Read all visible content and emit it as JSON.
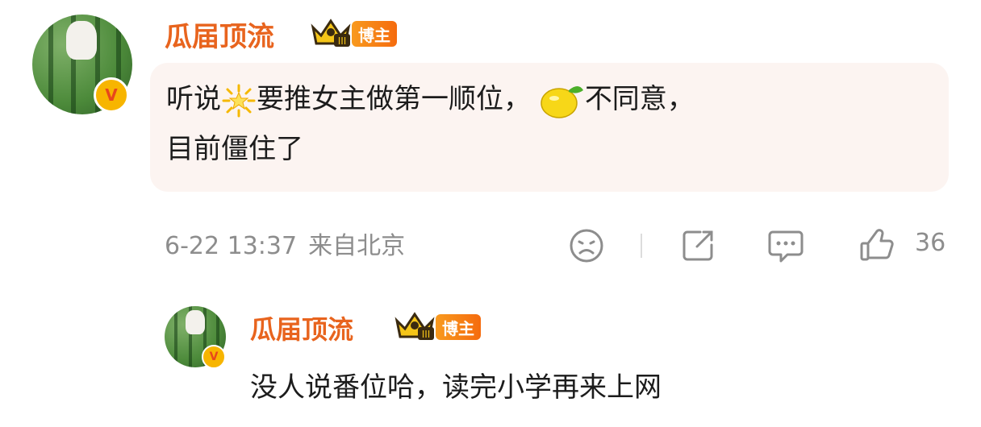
{
  "comment": {
    "author": "瓜届顶流",
    "role_badge": "博主",
    "text_part1": "听说",
    "text_part2": "要推女主做第一顺位，",
    "text_part3": "不同意，",
    "text_line2": "目前僵住了",
    "emoji1": "sun-emoji",
    "emoji2": "lemon-emoji",
    "time": "6-22 13:37",
    "location": "来自北京",
    "like_count": "36"
  },
  "reply": {
    "author": "瓜届顶流",
    "role_badge": "博主",
    "text": "没人说番位哈，读完小学再来上网"
  },
  "colors": {
    "username": "#e8641e",
    "bubble_bg": "#fcf4f1",
    "meta_gray": "#8d8d8d",
    "badge_orange": "#f56b0e"
  }
}
